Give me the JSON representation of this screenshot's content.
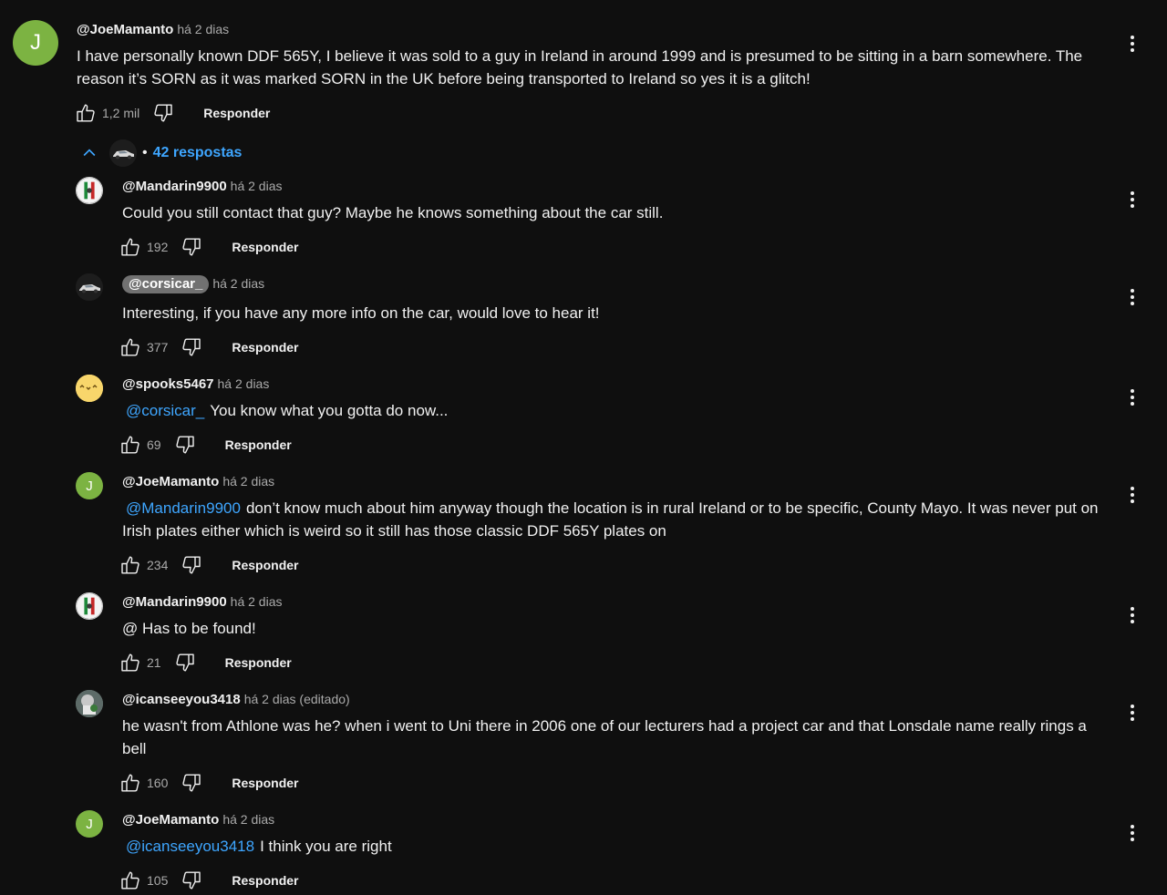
{
  "top_comment": {
    "avatar_letter": "J",
    "author": "@JoeMamanto",
    "time": "há 2 dias",
    "text": "I have personally known DDF 565Y, I believe it was sold to a guy in Ireland in around 1999 and is presumed to be sitting in a barn somewhere. The reason it’s SORN as it was marked SORN in the UK before being transported to Ireland so yes it is a glitch!",
    "likes": "1,2 mil",
    "reply_label": "Responder"
  },
  "replies_toggle": {
    "label": "42 respostas",
    "dot": "•"
  },
  "replies": [
    {
      "author": "@Mandarin9900",
      "time": "há 2 dias",
      "mention": "",
      "text": "Could you still contact that guy? Maybe he knows something about the car still.",
      "likes": "192",
      "reply_label": "Responder"
    },
    {
      "author": "@corsicar_",
      "time": "há 2 dias",
      "mention": "",
      "text": "Interesting, if you have any more info on the car, would love to hear it!",
      "likes": "377",
      "reply_label": "Responder"
    },
    {
      "author": "@spooks5467",
      "time": "há 2 dias",
      "mention": "@corsicar_",
      "text": "You know what you gotta do now...",
      "likes": "69",
      "reply_label": "Responder"
    },
    {
      "author": "@JoeMamanto",
      "avatar_letter": "J",
      "time": "há 2 dias",
      "mention": "@Mandarin9900",
      "text": "don’t know much about him anyway though the location is in rural Ireland or to be specific, County Mayo. It was never put on Irish plates either which is weird so it still has those classic DDF 565Y plates on",
      "likes": "234",
      "reply_label": "Responder"
    },
    {
      "author": "@Mandarin9900",
      "time": "há 2 dias",
      "mention": "",
      "text": "@ Has to be found!",
      "likes": "21",
      "reply_label": "Responder"
    },
    {
      "author": "@icanseeyou3418",
      "time": "há 2 dias (editado)",
      "mention": "",
      "text": "he wasn't from Athlone was he? when i went to Uni there in 2006 one of our lecturers had a project car and that Lonsdale name really rings a bell",
      "likes": "160",
      "reply_label": "Responder"
    },
    {
      "author": "@JoeMamanto",
      "avatar_letter": "J",
      "time": "há 2 dias",
      "mention": "@icanseeyou3418",
      "text": "I think you are right",
      "likes": "105",
      "reply_label": "Responder"
    }
  ],
  "icons": {
    "like": "thumbs-up-icon",
    "dislike": "thumbs-down-icon",
    "more": "more-vert-icon",
    "collapse": "chevron-up-icon"
  },
  "colors": {
    "background": "#0f0f0f",
    "text": "#f1f1f1",
    "secondary": "#aaaaaa",
    "link": "#3ea6ff",
    "avatar_green": "#7cb342"
  }
}
